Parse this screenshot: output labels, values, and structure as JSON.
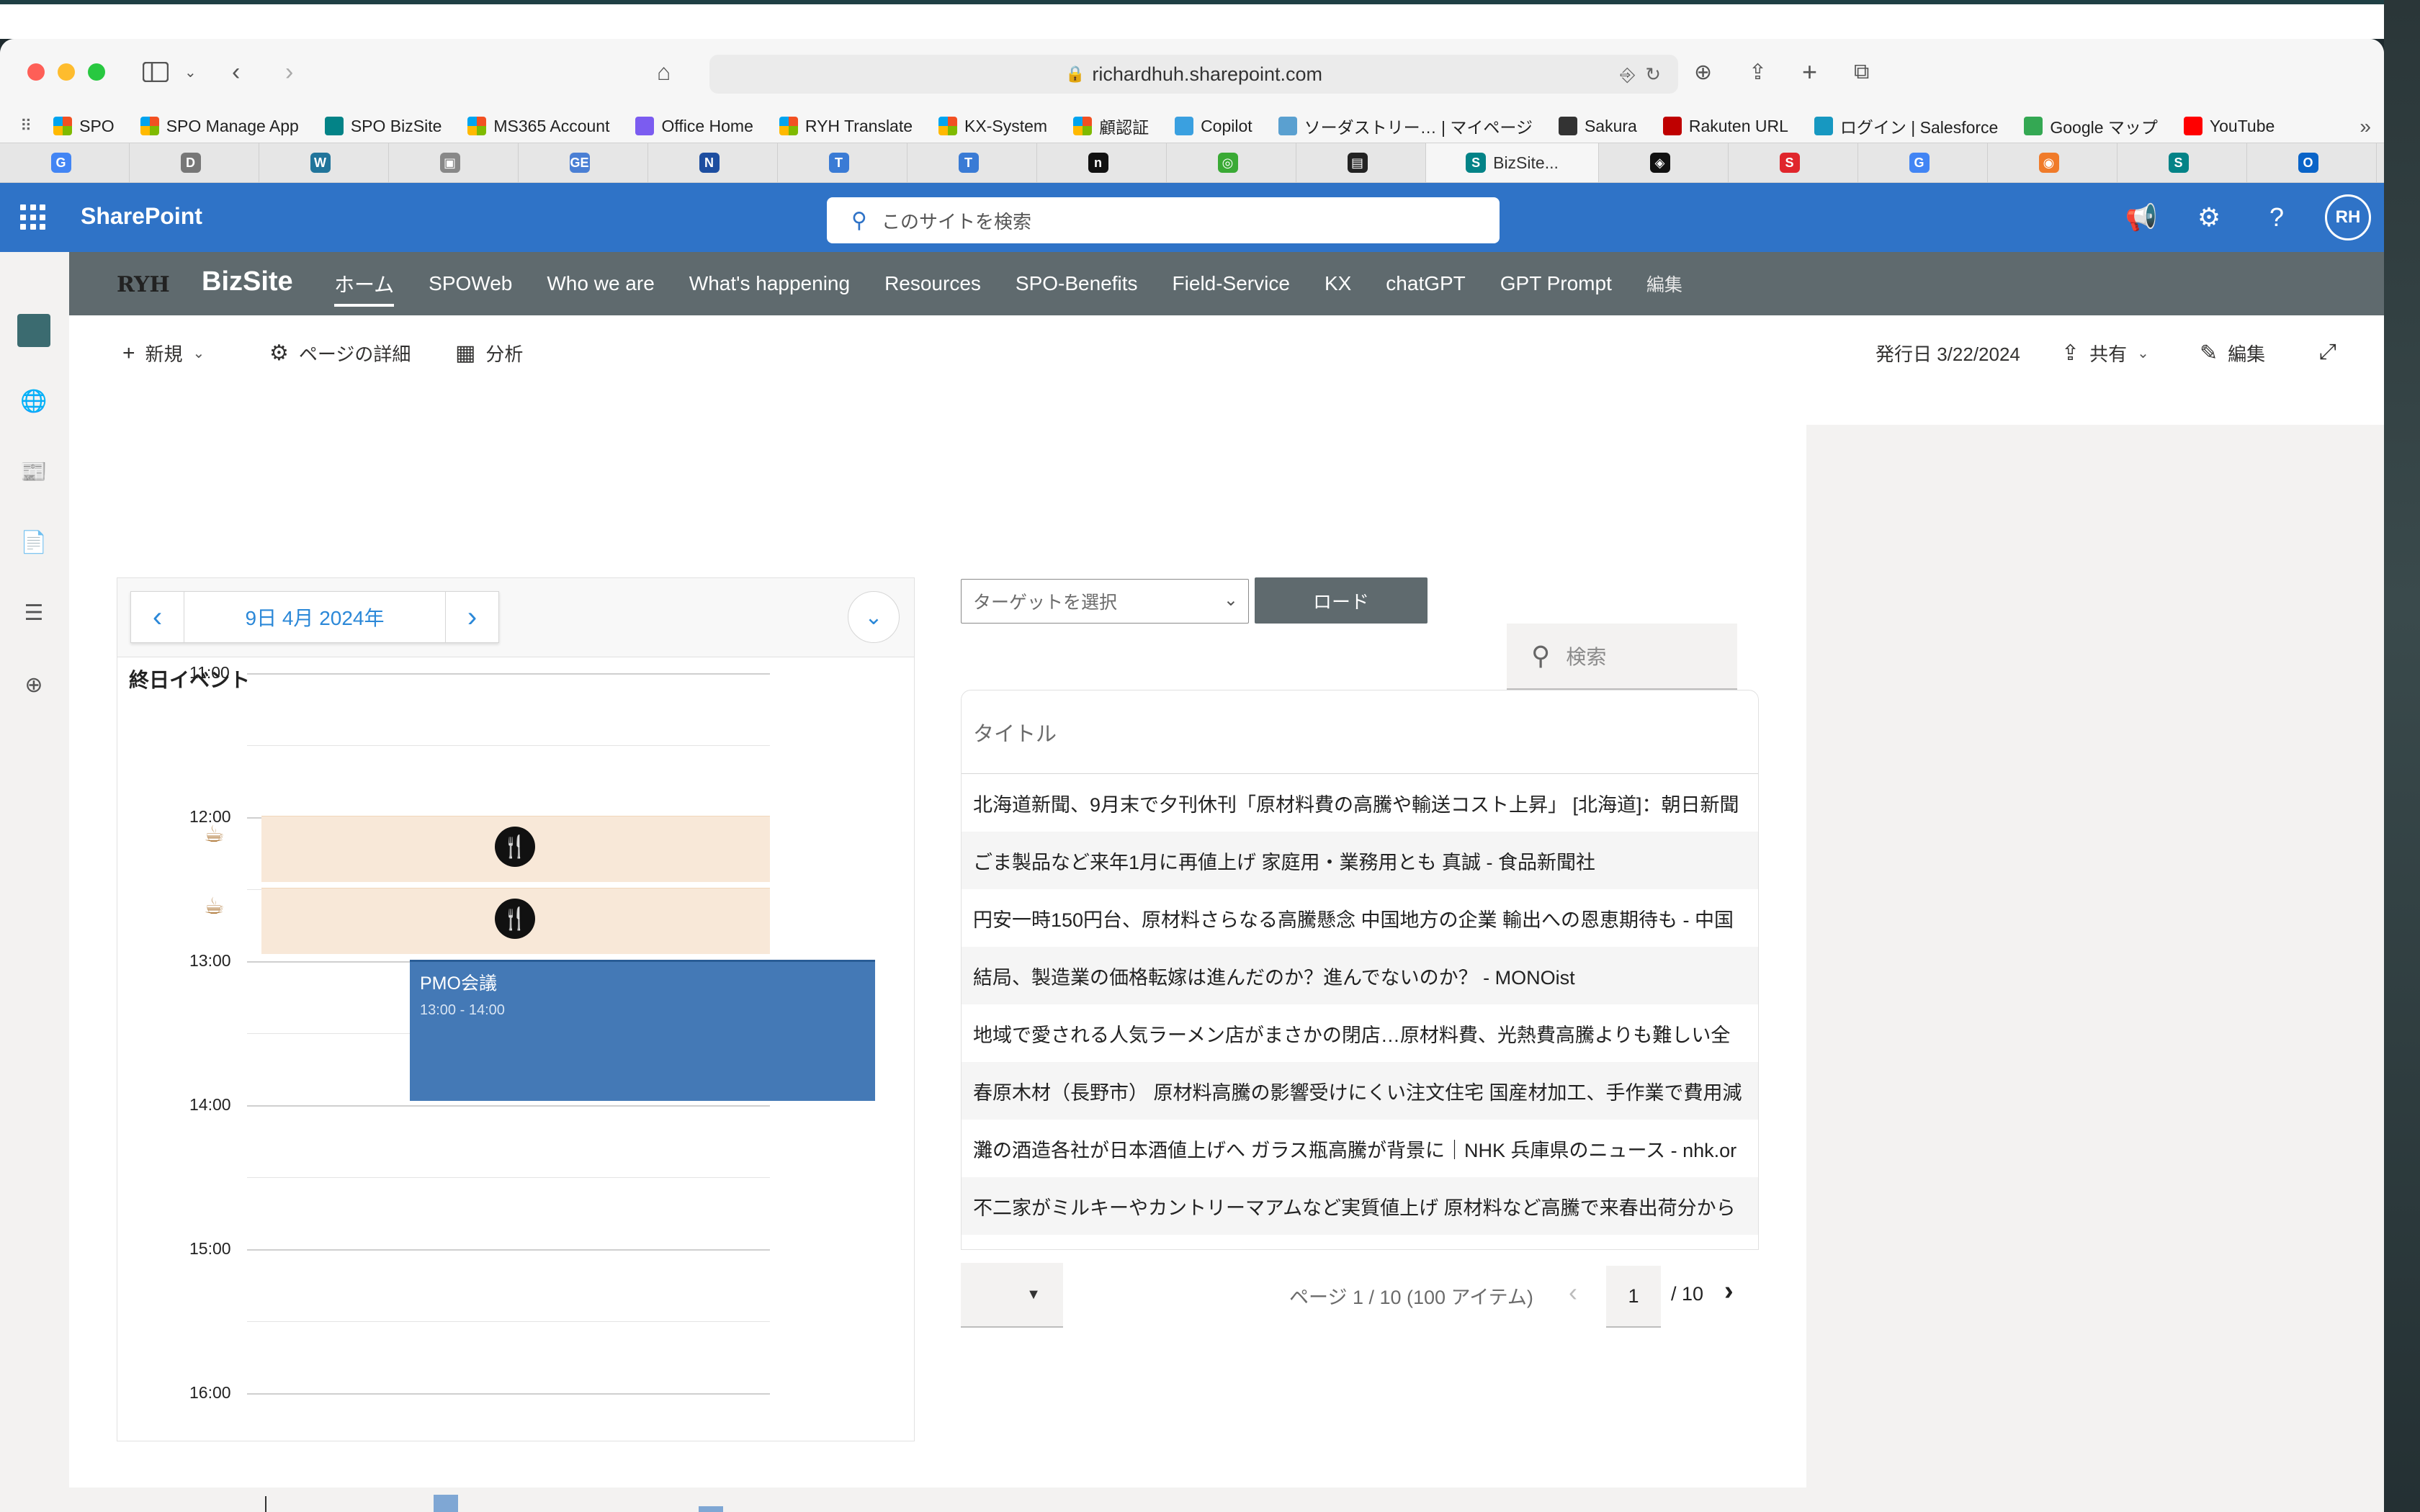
{
  "browser": {
    "url": "richardhuh.sharepoint.com",
    "bookmarks": [
      {
        "label": "SPO",
        "icon": "ms-icon",
        "color": "#f25022"
      },
      {
        "label": "SPO Manage App",
        "icon": "ms-icon",
        "color": "#f25022"
      },
      {
        "label": "SPO BizSite",
        "icon": "sharepoint-icon",
        "color": "#038387"
      },
      {
        "label": "MS365 Account",
        "icon": "ms-icon",
        "color": "#f25022"
      },
      {
        "label": "Office Home",
        "icon": "office-icon",
        "color": "#7b5cf0"
      },
      {
        "label": "RYH Translate",
        "icon": "ms-icon",
        "color": "#f25022"
      },
      {
        "label": "KX-System",
        "icon": "ms-icon",
        "color": "#f25022"
      },
      {
        "label": "顧認証",
        "icon": "ms-icon",
        "color": "#f25022"
      },
      {
        "label": "Copilot",
        "icon": "copilot-icon",
        "color": "#3aa0e0"
      },
      {
        "label": "ソーダストリー… | マイページ",
        "icon": "soda-icon",
        "color": "#5aa0d0"
      },
      {
        "label": "Sakura",
        "icon": "sakura-icon",
        "color": "#333333"
      },
      {
        "label": "Rakuten URL",
        "icon": "rakuten-icon",
        "color": "#bf0000"
      },
      {
        "label": "ログイン | Salesforce",
        "icon": "salesforce-icon",
        "color": "#1798c1"
      },
      {
        "label": "Google マップ",
        "icon": "maps-icon",
        "color": "#34a853"
      },
      {
        "label": "YouTube",
        "icon": "youtube-icon",
        "color": "#ff0000"
      }
    ],
    "tabs": [
      {
        "label": "",
        "icon": "google-icon",
        "color": "#4285f4",
        "glyph": "G"
      },
      {
        "label": "",
        "icon": "d-icon",
        "color": "#777777",
        "glyph": "D"
      },
      {
        "label": "",
        "icon": "wordpress-icon",
        "color": "#21759b",
        "glyph": "W"
      },
      {
        "label": "",
        "icon": "image-icon",
        "color": "#888888",
        "glyph": "▣"
      },
      {
        "label": "",
        "icon": "ge-icon",
        "color": "#4a7fd4",
        "glyph": "GE"
      },
      {
        "label": "",
        "icon": "nhk-icon",
        "color": "#1d4ea0",
        "glyph": "N"
      },
      {
        "label": "",
        "icon": "t-icon",
        "color": "#3a7bd5",
        "glyph": "T"
      },
      {
        "label": "",
        "icon": "t-icon",
        "color": "#3a7bd5",
        "glyph": "T"
      },
      {
        "label": "",
        "icon": "notion-icon",
        "color": "#111111",
        "glyph": "n"
      },
      {
        "label": "",
        "icon": "refresh-green-icon",
        "color": "#3aaa35",
        "glyph": "◎"
      },
      {
        "label": "",
        "icon": "media-icon",
        "color": "#222222",
        "glyph": "▤"
      },
      {
        "label": "BizSite...",
        "icon": "sharepoint-icon",
        "color": "#038387",
        "glyph": "S",
        "active": true
      },
      {
        "label": "",
        "icon": "codepen-icon",
        "color": "#111111",
        "glyph": "◈"
      },
      {
        "label": "",
        "icon": "red-logo-icon",
        "color": "#e0262c",
        "glyph": "S"
      },
      {
        "label": "",
        "icon": "google-icon",
        "color": "#4285f4",
        "glyph": "G"
      },
      {
        "label": "",
        "icon": "orange-icon",
        "color": "#f07b2a",
        "glyph": "◉"
      },
      {
        "label": "",
        "icon": "sharepoint-icon",
        "color": "#038387",
        "glyph": "S"
      },
      {
        "label": "",
        "icon": "outlook-icon",
        "color": "#0a64c8",
        "glyph": "O"
      }
    ]
  },
  "suite": {
    "app_name": "SharePoint",
    "search_placeholder": "このサイトを検索",
    "avatar_initials": "RH"
  },
  "site": {
    "logo_text": "RYH",
    "name": "BizSite",
    "nav": [
      "ホーム",
      "SPOWeb",
      "Who we are",
      "What's happening",
      "Resources",
      "SPO-Benefits",
      "Field-Service",
      "KX",
      "chatGPT",
      "GPT Prompt"
    ],
    "nav_edit": "編集"
  },
  "command_bar": {
    "new": "新規",
    "page_details": "ページの詳細",
    "analytics": "分析",
    "published": "発行日 3/22/2024",
    "share": "共有",
    "edit": "編集"
  },
  "calendar": {
    "date": "9日 4月 2024年",
    "all_day": "終日イベント",
    "hours": [
      "11:00",
      "12:00",
      "13:00",
      "14:00",
      "15:00",
      "16:00"
    ],
    "event": {
      "title": "PMO会議",
      "time": "13:00 - 14:00"
    }
  },
  "news": {
    "target_placeholder": "ターゲットを選択",
    "load_button": "ロード",
    "search_placeholder": "検索",
    "column_title": "タイトル",
    "items": [
      "北海道新聞、9月末で夕刊休刊「原材料費の高騰や輸送コスト上昇」 [北海道]：朝日新聞",
      "ごま製品など来年1月に再値上げ 家庭用・業務用とも 真誠 - 食品新聞社",
      "円安一時150円台、原材料さらなる高騰懸念 中国地方の企業 輸出への恩恵期待も - 中国",
      "結局、製造業の価格転嫁は進んだのか？進んでないのか？ - MONOist",
      "地域で愛される人気ラーメン店がまさかの閉店…原材料費、光熱費高騰よりも難しい全",
      "春原木材（長野市） 原材料高騰の影響受けにくい注文住宅 国産材加工、手作業で費用減",
      "灘の酒造各社が日本酒値上げへ ガラス瓶高騰が背景に｜NHK 兵庫県のニュース - nhk.or",
      "不二家がミルキーやカントリーマアムなど実質値上げ 原材料など高騰で来春出荷分から"
    ],
    "page_info": "ページ 1 / 10 (100 アイテム)",
    "current_page": "1",
    "total_pages": "/ 10"
  }
}
